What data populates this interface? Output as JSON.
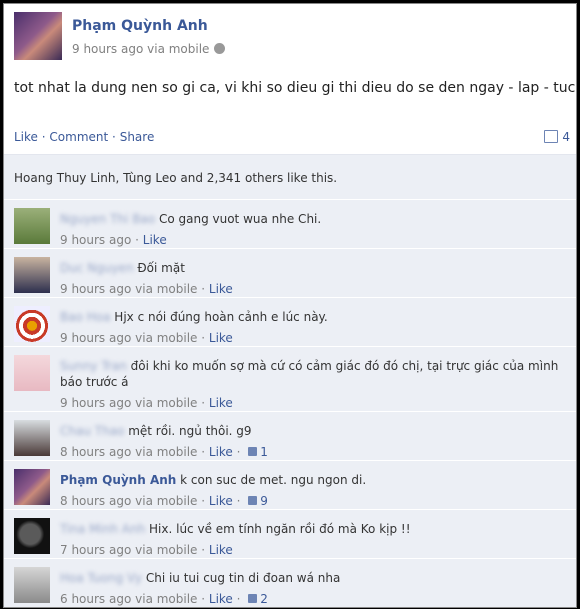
{
  "post": {
    "author": "Phạm Quỳnh Anh",
    "time": "9 hours ago via mobile",
    "text": "tot nhat la dung nen so gi ca, vi khi so dieu gi thi dieu do se den ngay - lap - tuc.",
    "actions": {
      "like": "Like",
      "comment": "Comment",
      "share": "Share"
    },
    "comment_count": "4",
    "likes_text": "Hoang Thuy Linh, Tùng Leo and 2,341 others like this."
  },
  "comments": [
    {
      "author": "Nguyen Thi Bao",
      "text": "Co gang vuot wua nhe Chi.",
      "time": "9 hours ago",
      "like": "Like",
      "likes": ""
    },
    {
      "author": "Duc Nguyen",
      "text": "Đối mặt",
      "time": "9 hours ago via mobile",
      "like": "Like",
      "likes": ""
    },
    {
      "author": "Bao Hoa",
      "text": "Hjx c nói đúng hoàn cảnh e lúc này.",
      "time": "9 hours ago via mobile",
      "like": "Like",
      "likes": ""
    },
    {
      "author": "Sunny Tran",
      "text": "đôi khi ko muốn sợ mà cứ có cảm giác đó đó chị, tại trực giác của mình báo trước á",
      "time": "9 hours ago via mobile",
      "like": "Like",
      "likes": ""
    },
    {
      "author": "Chau Thao",
      "text": "mệt rồi. ngủ thôi. g9",
      "time": "8 hours ago via mobile",
      "like": "Like",
      "likes": "1"
    },
    {
      "author": "Phạm Quỳnh Anh",
      "text": "k con suc de met. ngu ngon di.",
      "time": "8 hours ago via mobile",
      "like": "Like",
      "likes": "9"
    },
    {
      "author": "Tina Minh Anh",
      "text": "Hix. lúc về em tính ngăn rồi đó mà Ko kịp !!",
      "time": "7 hours ago via mobile",
      "like": "Like",
      "likes": ""
    },
    {
      "author": "Hoa Tuong Vy",
      "text": "Chi iu tui cug tin di đoan wá nha",
      "time": "6 hours ago via mobile",
      "like": "Like",
      "likes": "2"
    }
  ]
}
